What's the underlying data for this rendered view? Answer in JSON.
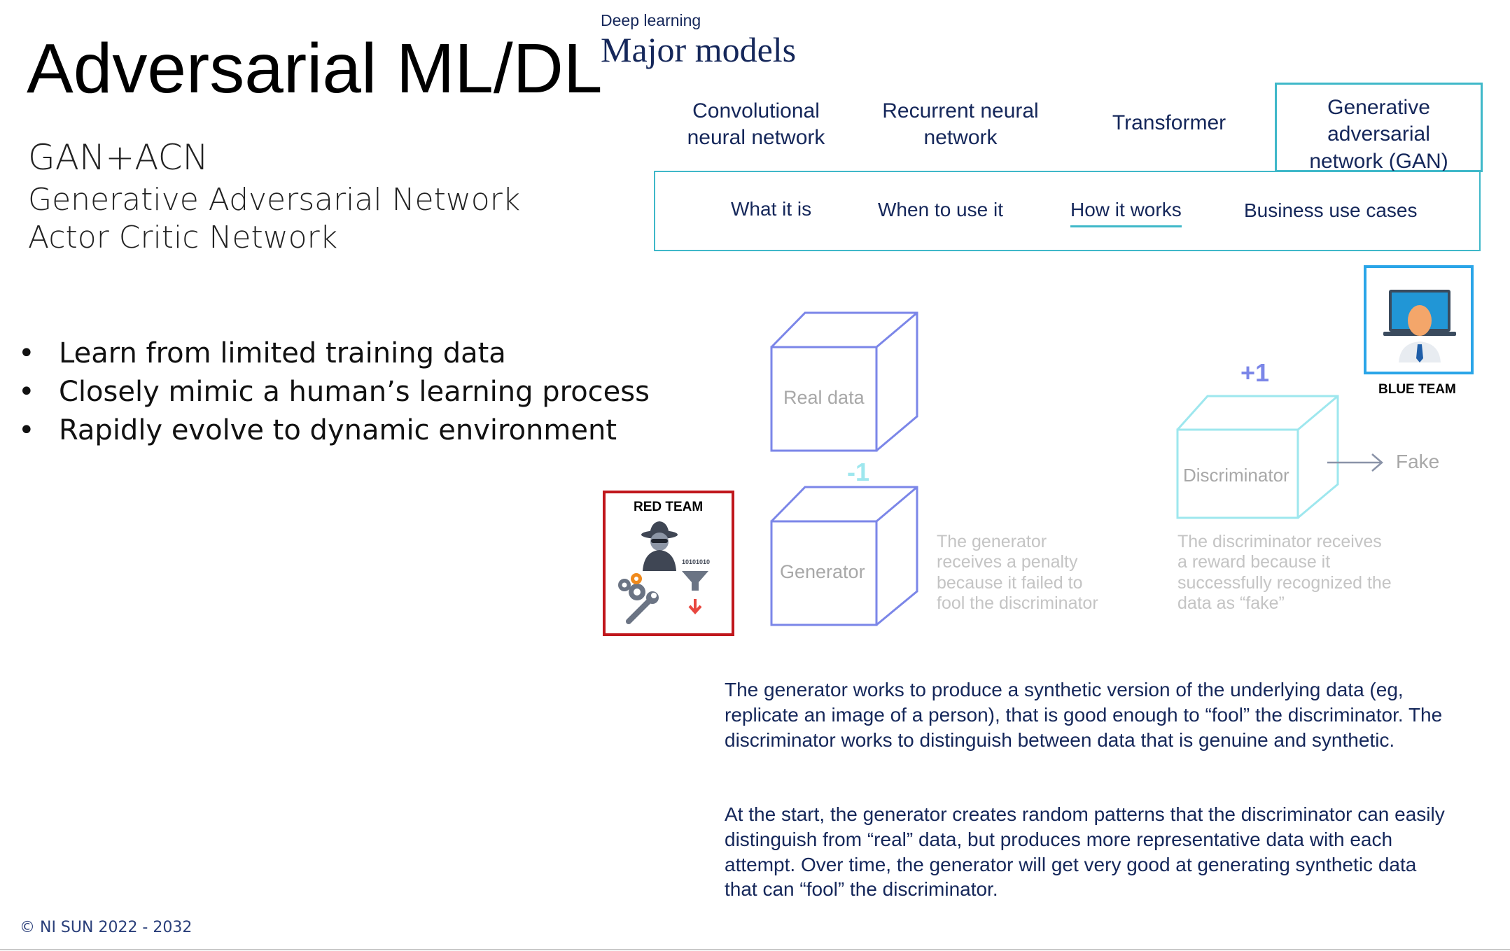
{
  "slide": {
    "title": "Adversarial ML/DL",
    "subtitle": "GAN+ACN",
    "subtitle_lines": [
      "Generative Adversarial Network",
      "Actor Critic Network"
    ],
    "bullets": [
      "Learn from limited training data",
      "Closely mimic a human’s learning process",
      "Rapidly evolve to dynamic environment"
    ],
    "footer": "© NI SUN 2022 - 2032"
  },
  "embedded": {
    "section_label": "Deep learning",
    "heading": "Major models",
    "model_tabs": [
      {
        "label": "Convolutional neural network",
        "active": false
      },
      {
        "label": "Recurrent neural network",
        "active": false
      },
      {
        "label": "Transformer",
        "active": false
      },
      {
        "label": "Generative adversarial network (GAN)",
        "active": true
      }
    ],
    "sub_tabs": [
      {
        "label": "What it is",
        "active": false
      },
      {
        "label": "When to use it",
        "active": false
      },
      {
        "label": "How it works",
        "active": true
      },
      {
        "label": "Business use cases",
        "active": false
      }
    ],
    "diagram": {
      "real_data": "Real data",
      "generator": "Generator",
      "discriminator": "Discriminator",
      "fake": "Fake",
      "generator_score": "-1",
      "discriminator_score": "+1",
      "generator_caption": "The generator receives a penalty because it failed to fool the discriminator",
      "discriminator_caption": "The discriminator receives a reward because it successfully recognized the data as “fake”"
    },
    "paragraphs": [
      "The generator works to produce a synthetic version of the underlying data (eg, replicate an image of a person), that is good enough to “fool” the discriminator. The discriminator works to distinguish between data that is genuine and synthetic.",
      "At the start, the generator creates random patterns that the discriminator can easily distinguish from “real” data, but produces more representative data with each attempt. Over time, the generator will get very good at generating synthetic data that can “fool” the discriminator."
    ]
  },
  "red_team": {
    "label": "RED TEAM",
    "binary_text": "10101010"
  },
  "blue_team": {
    "label": "BLUE TEAM"
  },
  "colors": {
    "navy": "#15275a",
    "teal": "#3fb8c9",
    "generator_blue": "#7b86e8",
    "discriminator_cyan": "#9ee7ee",
    "red_team_border": "#c0171c",
    "blue_team_border": "#2aa5e8"
  }
}
